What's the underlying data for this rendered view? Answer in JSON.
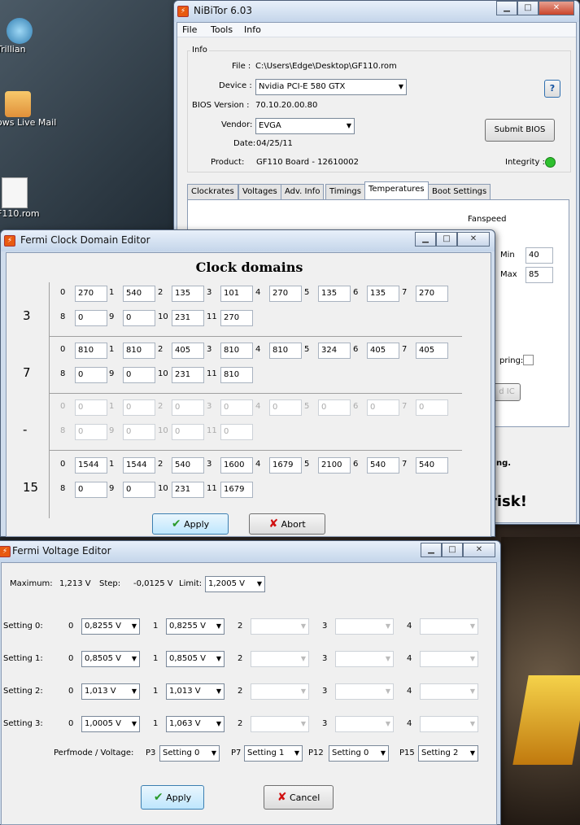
{
  "desktop": {
    "icons": [
      "Trillian",
      "ows Live Mail",
      "F110.rom"
    ],
    "risk_text": "risk!",
    "ng_text": "ng."
  },
  "nibitor": {
    "title": "NiBiTor 6.03",
    "menu": [
      "File",
      "Tools",
      "Info"
    ],
    "info_group": "Info",
    "file_label": "File :",
    "file_value": "C:\\Users\\Edge\\Desktop\\GF110.rom",
    "device_label": "Device :",
    "device_value": "Nvidia PCI-E 580 GTX",
    "bios_label": "BIOS Version :",
    "bios_value": "70.10.20.00.80",
    "vendor_label": "Vendor:",
    "vendor_value": "EVGA",
    "date_label": "Date:",
    "date_value": "04/25/11",
    "product_label": "Product:",
    "product_value": "GF110 Board - 12610002",
    "help_label": "?",
    "submit_label": "Submit BIOS",
    "integrity_label": "Integrity :",
    "tabs": [
      "Clockrates",
      "Voltages",
      "Adv. Info",
      "Timings",
      "Temperatures",
      "Boot Settings"
    ],
    "fanspeed_label": "Fanspeed",
    "min_label": "Min",
    "min_value": "40",
    "max_label": "Max",
    "max_value": "85",
    "monitoring_label": "pring:",
    "ic_label": "d IC"
  },
  "clock": {
    "title": "Fermi Clock Domain Editor",
    "heading": "Clock domains",
    "rows": [
      {
        "label": "3",
        "disabled": false,
        "values": [
          "270",
          "540",
          "135",
          "101",
          "270",
          "135",
          "135",
          "270",
          "0",
          "0",
          "231",
          "270"
        ]
      },
      {
        "label": "7",
        "disabled": false,
        "values": [
          "810",
          "810",
          "405",
          "810",
          "810",
          "324",
          "405",
          "405",
          "0",
          "0",
          "231",
          "810"
        ]
      },
      {
        "label": "-",
        "disabled": true,
        "values": [
          "0",
          "0",
          "0",
          "0",
          "0",
          "0",
          "0",
          "0",
          "0",
          "0",
          "0",
          "0"
        ]
      },
      {
        "label": "15",
        "disabled": false,
        "values": [
          "1544",
          "1544",
          "540",
          "1600",
          "1679",
          "2100",
          "540",
          "540",
          "0",
          "0",
          "231",
          "1679"
        ]
      }
    ],
    "idx": [
      "0",
      "1",
      "2",
      "3",
      "4",
      "5",
      "6",
      "7",
      "8",
      "9",
      "10",
      "11"
    ],
    "apply_label": "Apply",
    "abort_label": "Abort"
  },
  "volt": {
    "title": "Fermi Voltage Editor",
    "max_label": "Maximum:",
    "max_value": "1,213 V",
    "step_label": "Step:",
    "step_value": "-0,0125 V",
    "limit_label": "Limit:",
    "limit_value": "1,2005 V",
    "settings": [
      {
        "label": "Setting 0:",
        "v0": "0,8255 V",
        "v1": "0,8255 V"
      },
      {
        "label": "Setting 1:",
        "v0": "0,8505 V",
        "v1": "0,8505 V"
      },
      {
        "label": "Setting 2:",
        "v0": "1,013 V",
        "v1": "1,013 V"
      },
      {
        "label": "Setting 3:",
        "v0": "1,0005 V",
        "v1": "1,063 V"
      }
    ],
    "idx": [
      "0",
      "1",
      "2",
      "3",
      "4"
    ],
    "perf_label": "Perfmode / Voltage:",
    "p3_label": "P3",
    "p3_value": "Setting 0",
    "p7_label": "P7",
    "p7_value": "Setting 1",
    "p12_label": "P12",
    "p12_value": "Setting 0",
    "p15_label": "P15",
    "p15_value": "Setting 2",
    "apply_label": "Apply",
    "cancel_label": "Cancel"
  },
  "colors": {
    "integrity_ok": "#2ec02e",
    "apply_check": "#2a9a2a",
    "abort_x": "#d01010"
  }
}
